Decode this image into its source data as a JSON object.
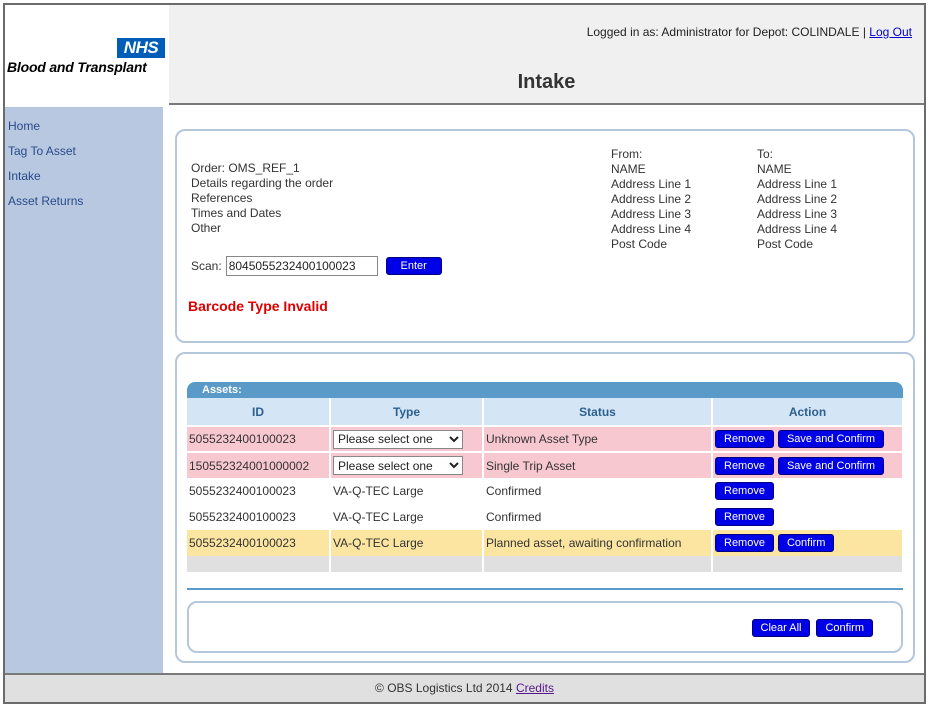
{
  "header": {
    "logo_badge": "NHS",
    "logo_text": "Blood and Transplant",
    "login_text": "Logged in as: Administrator for Depot: COLINDALE |",
    "logout_label": "Log Out",
    "page_title": "Intake"
  },
  "sidebar": {
    "items": [
      {
        "label": "Home"
      },
      {
        "label": "Tag To Asset"
      },
      {
        "label": "Intake"
      },
      {
        "label": "Asset Returns"
      }
    ]
  },
  "order": {
    "lines": [
      "Order: OMS_REF_1",
      "Details regarding the order",
      "References",
      "Times and Dates",
      "Other"
    ],
    "from": [
      "From:",
      "NAME",
      "Address Line 1",
      "Address Line 2",
      "Address Line 3",
      "Address Line 4",
      "Post Code"
    ],
    "to": [
      "To:",
      "NAME",
      "Address Line 1",
      "Address Line 2",
      "Address Line 3",
      "Address Line 4",
      "Post Code"
    ],
    "scan_label": "Scan:",
    "scan_value": "8045055232400100023",
    "enter_label": "Enter",
    "error": "Barcode Type Invalid"
  },
  "assets": {
    "bar_label": "Assets:",
    "columns": [
      "ID",
      "Type",
      "Status",
      "Action"
    ],
    "rows": [
      {
        "id": "5055232400100023",
        "type": "Please select one",
        "status": "Unknown Asset Type",
        "remove": "Remove",
        "confirm": "Save and Confirm"
      },
      {
        "id": "150552324001000002",
        "type": "Please select one",
        "status": "Single Trip Asset",
        "remove": "Remove",
        "confirm": "Save and Confirm"
      },
      {
        "id": "5055232400100023",
        "type": "VA-Q-TEC Large",
        "status": "Confirmed",
        "remove": "Remove"
      },
      {
        "id": "5055232400100023",
        "type": "VA-Q-TEC Large",
        "status": "Confirmed",
        "remove": "Remove"
      },
      {
        "id": "5055232400100023",
        "type": "VA-Q-TEC Large",
        "status": "Planned asset, awaiting confirmation",
        "remove": "Remove",
        "confirm": "Confirm"
      }
    ],
    "clear_all_label": "Clear All",
    "confirm_label": "Confirm"
  },
  "footer": {
    "text": "© OBS Logistics Ltd 2014",
    "credits_label": "Credits"
  },
  "colors": {
    "nhs_blue": "#005eb8",
    "button_blue": "#0000e6",
    "error_red": "#dd0000",
    "row_error": "#f8c8d0",
    "row_pending": "#fbe5a0",
    "sidebar": "#b8c8e0"
  }
}
